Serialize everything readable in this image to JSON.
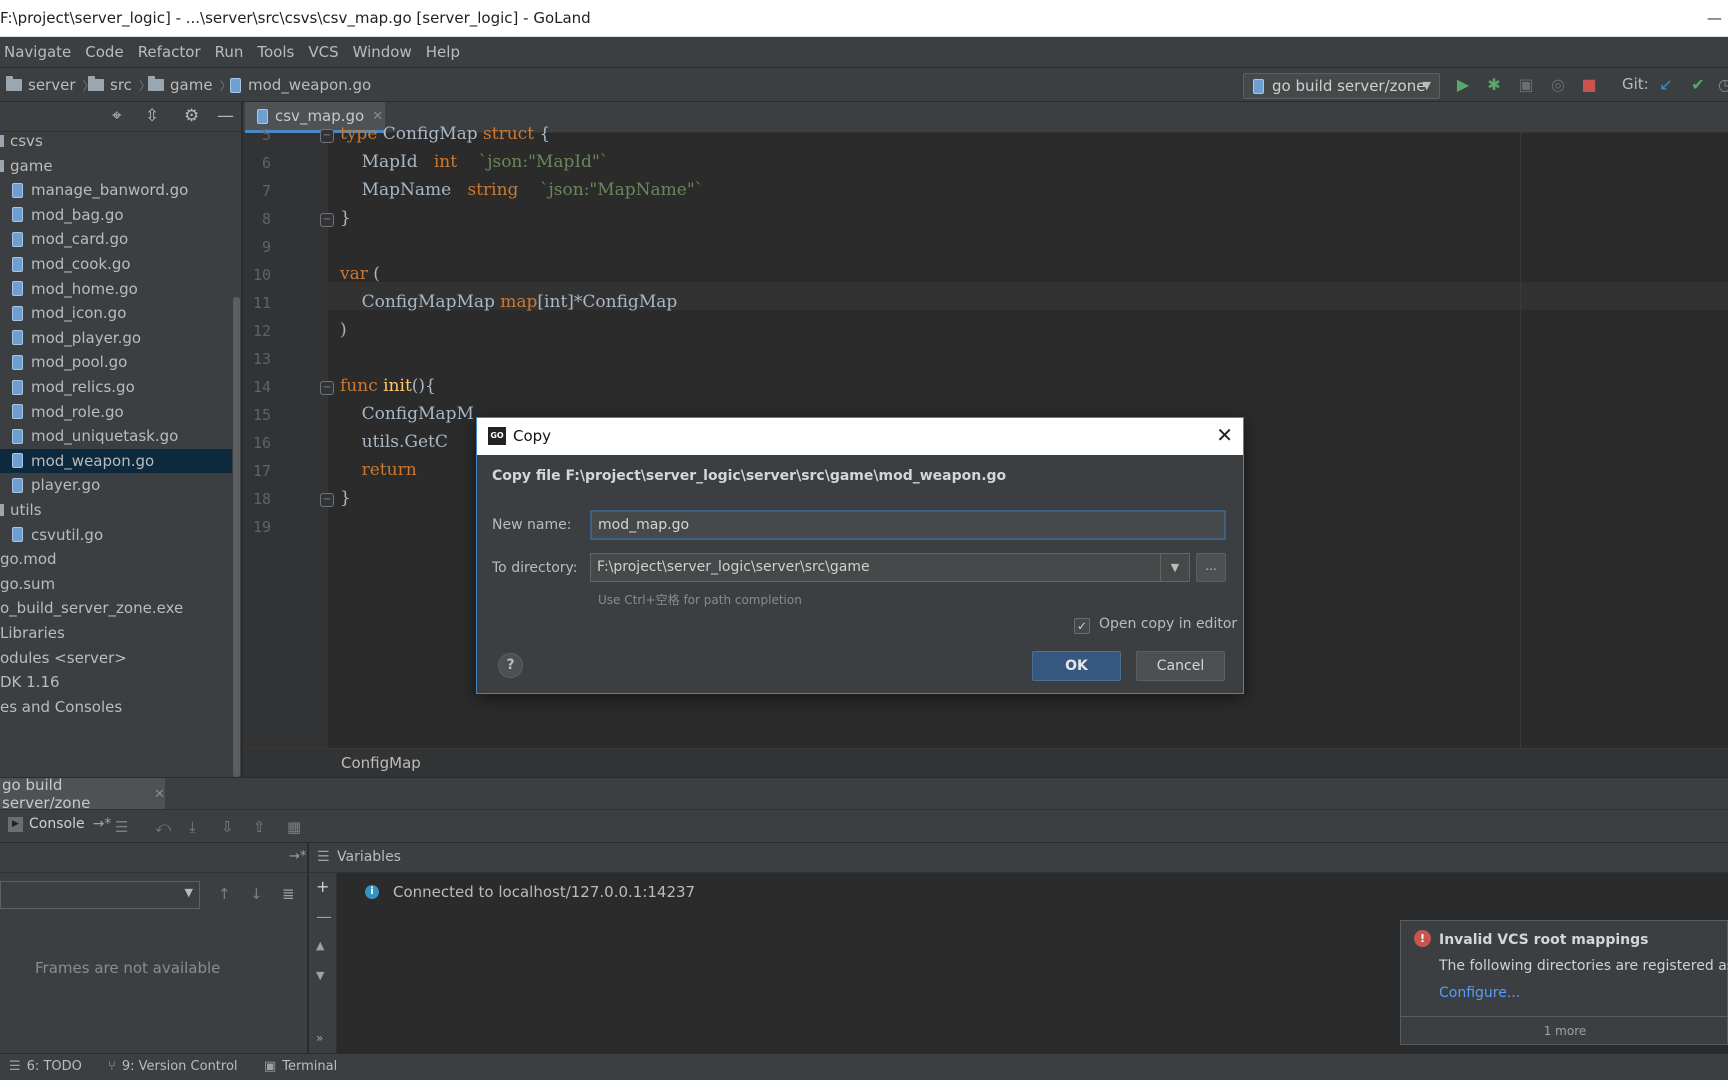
{
  "window": {
    "title": "F:\\project\\server_logic] - ...\\server\\src\\csvs\\csv_map.go [server_logic] - GoLand",
    "min": "—"
  },
  "menu": [
    "Navigate",
    "Code",
    "Refactor",
    "Run",
    "Tools",
    "VCS",
    "Window",
    "Help"
  ],
  "breadcrumb": [
    "server",
    "src",
    "game",
    "mod_weapon.go"
  ],
  "toolbar": {
    "run_config": "go build server/zone",
    "git_label": "Git:"
  },
  "project_tree": [
    {
      "label": "csvs",
      "kind": "folder"
    },
    {
      "label": "game",
      "kind": "folder"
    },
    {
      "label": "manage_banword.go",
      "kind": "file"
    },
    {
      "label": "mod_bag.go",
      "kind": "file"
    },
    {
      "label": "mod_card.go",
      "kind": "file"
    },
    {
      "label": "mod_cook.go",
      "kind": "file"
    },
    {
      "label": "mod_home.go",
      "kind": "file"
    },
    {
      "label": "mod_icon.go",
      "kind": "file"
    },
    {
      "label": "mod_player.go",
      "kind": "file"
    },
    {
      "label": "mod_pool.go",
      "kind": "file"
    },
    {
      "label": "mod_relics.go",
      "kind": "file"
    },
    {
      "label": "mod_role.go",
      "kind": "file"
    },
    {
      "label": "mod_uniquetask.go",
      "kind": "file"
    },
    {
      "label": "mod_weapon.go",
      "kind": "file",
      "selected": true
    },
    {
      "label": "player.go",
      "kind": "file"
    },
    {
      "label": "utils",
      "kind": "folder"
    },
    {
      "label": "csvutil.go",
      "kind": "file"
    },
    {
      "label": "go.mod",
      "kind": "plain"
    },
    {
      "label": "go.sum",
      "kind": "plain"
    },
    {
      "label": "o_build_server_zone.exe",
      "kind": "plain"
    },
    {
      "label": "Libraries",
      "kind": "plain"
    },
    {
      "label": "odules <server>",
      "kind": "plain"
    },
    {
      "label": "DK 1.16",
      "kind": "plain"
    },
    {
      "label": "es and Consoles",
      "kind": "plain"
    }
  ],
  "editor": {
    "tab_label": "csv_map.go",
    "line_numbers": [
      "5",
      "6",
      "7",
      "8",
      "9",
      "10",
      "11",
      "12",
      "13",
      "14",
      "15",
      "16",
      "17",
      "18",
      "19"
    ],
    "code": {
      "l5_kw": "type",
      "l5_name": " ConfigMap ",
      "l5_kw2": "struct",
      "l5_rest": " {",
      "l6_field": "    MapId   ",
      "l6_type": "int",
      "l6_tag": "    `json:\"MapId\"`",
      "l7_field": "    MapName   ",
      "l7_type": "string",
      "l7_tag": "    `json:\"MapName\"`",
      "l8": "}",
      "l10_kw": "var",
      "l10_rest": " (",
      "l11_name": "    ConfigMapMap ",
      "l11_map": "map",
      "l11_rest": "[int]*ConfigMap",
      "l12": ")",
      "l14_kw": "func",
      "l14_fn": " init",
      "l14_rest": "(){",
      "l15": "    ConfigMapM",
      "l16": "    utils.GetC",
      "l17_kw": "    return",
      "l18": "}"
    },
    "breadcrumb": "ConfigMap"
  },
  "debug": {
    "tab_label": "go build server/zone",
    "console_label": "Console",
    "variables_label": "Variables",
    "frames_empty": "Frames are not available",
    "connected": "Connected to localhost/127.0.0.1:14237"
  },
  "statusbar": {
    "todo": "6: TODO",
    "vcs": "9: Version Control",
    "terminal": "Terminal"
  },
  "notification": {
    "title": "Invalid VCS root mappings",
    "message": "The following directories are registered as '",
    "link": "Configure...",
    "more": "1 more"
  },
  "dialog": {
    "title": "Copy",
    "heading": "Copy file F:\\project\\server_logic\\server\\src\\game\\mod_weapon.go",
    "new_name_label": "New name:",
    "new_name_value": "mod_map.go",
    "to_dir_label": "To directory:",
    "to_dir_value": "F:\\project\\server_logic\\server\\src\\game",
    "hint": "Use Ctrl+空格 for path completion",
    "open_copy_label": "Open copy in editor",
    "open_copy_checked": true,
    "ok": "OK",
    "cancel": "Cancel",
    "browse": "..."
  },
  "colors": {
    "accent": "#4a88c7",
    "selection": "#0d293e",
    "ok_button": "#365880",
    "keyword": "#cc7832",
    "string": "#6a8759"
  }
}
